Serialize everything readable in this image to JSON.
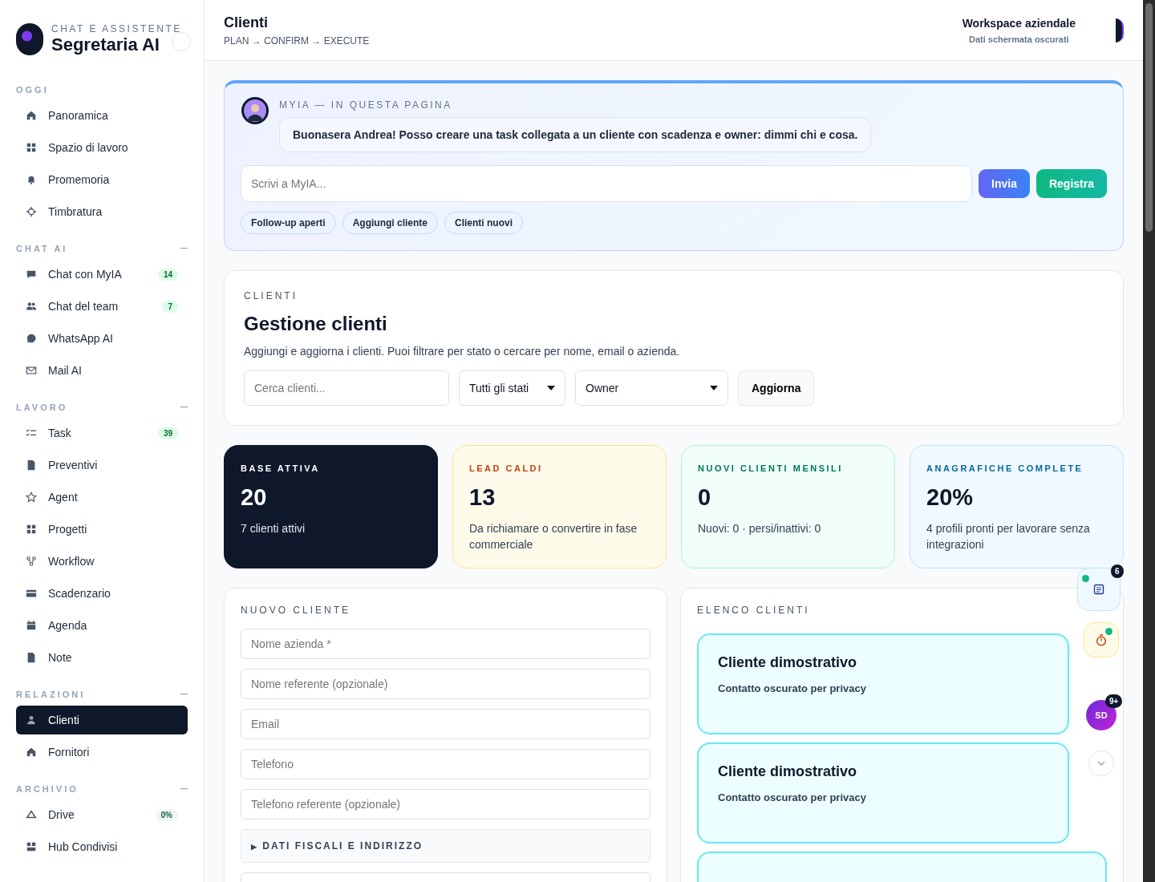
{
  "brand": {
    "eyebrow": "CHAT E ASSISTENTE",
    "name": "Segretaria AI"
  },
  "sidebar": {
    "sections": [
      {
        "title": "OGGI",
        "collapsible": false,
        "items": [
          {
            "label": "Panoramica",
            "selected": false
          },
          {
            "label": "Spazio di lavoro",
            "selected": false
          },
          {
            "label": "Promemoria",
            "selected": false
          },
          {
            "label": "Timbratura",
            "selected": false
          }
        ]
      },
      {
        "title": "CHAT AI",
        "collapsible": true,
        "items": [
          {
            "label": "Chat con MyIA",
            "selected": false,
            "badge": "14",
            "color": "#dcfce7"
          },
          {
            "label": "Chat del team",
            "selected": false,
            "badge": "7",
            "color": "#dcfce7"
          },
          {
            "label": "WhatsApp AI",
            "selected": false
          },
          {
            "label": "Mail AI",
            "selected": false
          }
        ]
      },
      {
        "title": "LAVORO",
        "collapsible": true,
        "items": [
          {
            "label": "Task",
            "selected": false,
            "badge": "39",
            "color": "#dcfce7"
          },
          {
            "label": "Preventivi",
            "selected": false
          },
          {
            "label": "Agent",
            "selected": false
          },
          {
            "label": "Progetti",
            "selected": false
          },
          {
            "label": "Workflow",
            "selected": false
          },
          {
            "label": "Scadenzario",
            "selected": false
          },
          {
            "label": "Agenda",
            "selected": false
          },
          {
            "label": "Note",
            "selected": false
          }
        ]
      },
      {
        "title": "RELAZIONI",
        "collapsible": true,
        "items": [
          {
            "label": "Clienti",
            "selected": true
          },
          {
            "label": "Fornitori",
            "selected": false
          }
        ]
      },
      {
        "title": "ARCHIVIO",
        "collapsible": true,
        "items": [
          {
            "label": "Drive",
            "selected": false,
            "badge": "0%",
            "color": "#f1f5f9"
          },
          {
            "label": "Hub Condivisi",
            "selected": false
          }
        ]
      }
    ]
  },
  "header": {
    "title": "Clienti",
    "breadcrumb": "PLAN → CONFIRM → EXECUTE",
    "workspace": "Workspace aziendale",
    "note": "Dati schermata oscurati"
  },
  "assistant": {
    "eyebrow": "MYIA — IN QUESTA PAGINA",
    "message": "Buonasera Andrea! Posso creare una task collegata a un cliente con scadenza e owner: dimmi chi e cosa.",
    "input": {
      "placeholder": "Scrivi a MyIA..."
    },
    "send": "Invia",
    "record": "Registra",
    "chips": [
      "Follow-up aperti",
      "Aggiungi cliente",
      "Clienti nuovi"
    ]
  },
  "management": {
    "eyebrow": "CLIENTI",
    "title": "Gestione clienti",
    "description": "Aggiungi e aggiorna i clienti. Puoi filtrare per stato o cercare per nome, email o azienda.",
    "search": {
      "placeholder": "Cerca clienti..."
    },
    "status_filter": "Tutti gli stati",
    "owner_filter": "Owner",
    "refresh": "Aggiorna"
  },
  "stats": [
    {
      "kind": "dark",
      "label": "BASE ATTIVA",
      "value": "20",
      "note": "7 clienti attivi"
    },
    {
      "kind": "amber",
      "label": "LEAD CALDI",
      "value": "13",
      "note": "Da richiamare o convertire in fase commerciale"
    },
    {
      "kind": "green",
      "label": "NUOVI CLIENTI MENSILI",
      "value": "0",
      "note": "Nuovi: 0 · persi/inattivi: 0"
    },
    {
      "kind": "blue",
      "label": "ANAGRAFICHE COMPLETE",
      "value": "20%",
      "note": "4 profili pronti per lavorare senza integrazioni"
    }
  ],
  "new_client": {
    "eyebrow": "NUOVO CLIENTE",
    "fields": [
      {
        "placeholder": "Nome azienda *"
      },
      {
        "placeholder": "Nome referente (opzionale)"
      },
      {
        "placeholder": "Email"
      },
      {
        "placeholder": "Telefono"
      },
      {
        "placeholder": "Telefono referente (opzionale)"
      }
    ],
    "section": {
      "marker": "▶",
      "label": "DATI FISCALI E INDIRIZZO",
      "expanded": false
    }
  },
  "client_list": {
    "eyebrow": "ELENCO CLIENTI",
    "clients": [
      {
        "name": "Cliente dimostrativo",
        "contact": "Contatto oscurato per privacy"
      },
      {
        "name": "Cliente dimostrativo",
        "contact": "Contatto oscurato per privacy"
      }
    ]
  },
  "floating": {
    "notes_badge": "6",
    "avatar": "SD",
    "avatar_badge": "9+"
  }
}
